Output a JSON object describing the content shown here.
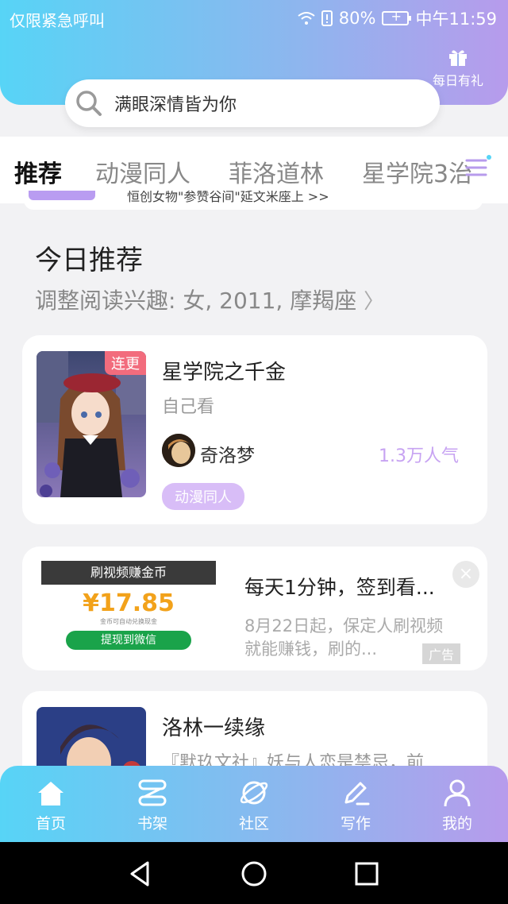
{
  "status_bar": {
    "carrier": "仅限紧急呼叫",
    "battery": "80%",
    "time": "中午11:59"
  },
  "header": {
    "gift_label": "每日有礼",
    "search_placeholder": "满眼深情皆为你"
  },
  "tabs": [
    {
      "label": "推荐",
      "active": true
    },
    {
      "label": "动漫同人",
      "active": false
    },
    {
      "label": "菲洛道林",
      "active": false
    },
    {
      "label": "星学院3治",
      "active": false
    }
  ],
  "peek": {
    "text": "恒创女物\"参赞谷间\"延文米座上 >>"
  },
  "section": {
    "title": "今日推荐",
    "subtitle": "调整阅读兴趣: 女, 2011, 摩羯座"
  },
  "books": [
    {
      "title": "星学院之千金",
      "subtitle": "自己看",
      "badge": "连更",
      "author": "奇洛梦",
      "popularity": "1.3万人气",
      "tag": "动漫同人"
    },
    {
      "title": "洛林一续缘",
      "subtitle": "『默玖文社』妖与人恋是禁忌，前..."
    }
  ],
  "ad": {
    "banner": "刷视频赚金币",
    "amount": "¥17.85",
    "small_text": "金币可自动兑换现金",
    "button": "提现到微信",
    "title": "每天1分钟，签到看...",
    "description": "8月22日起，保定人刷视频就能赚钱，刷的...",
    "label": "广告",
    "close": "×"
  },
  "bottom_nav": [
    {
      "label": "首页",
      "icon": "home-icon"
    },
    {
      "label": "书架",
      "icon": "bookshelf-icon"
    },
    {
      "label": "社区",
      "icon": "planet-icon"
    },
    {
      "label": "写作",
      "icon": "pen-icon"
    },
    {
      "label": "我的",
      "icon": "person-icon"
    }
  ],
  "colors": {
    "gradient_start": "#57d4f6",
    "gradient_end": "#b79bec",
    "accent_purple": "#c7a3f2",
    "badge_red": "#f26c7d"
  }
}
